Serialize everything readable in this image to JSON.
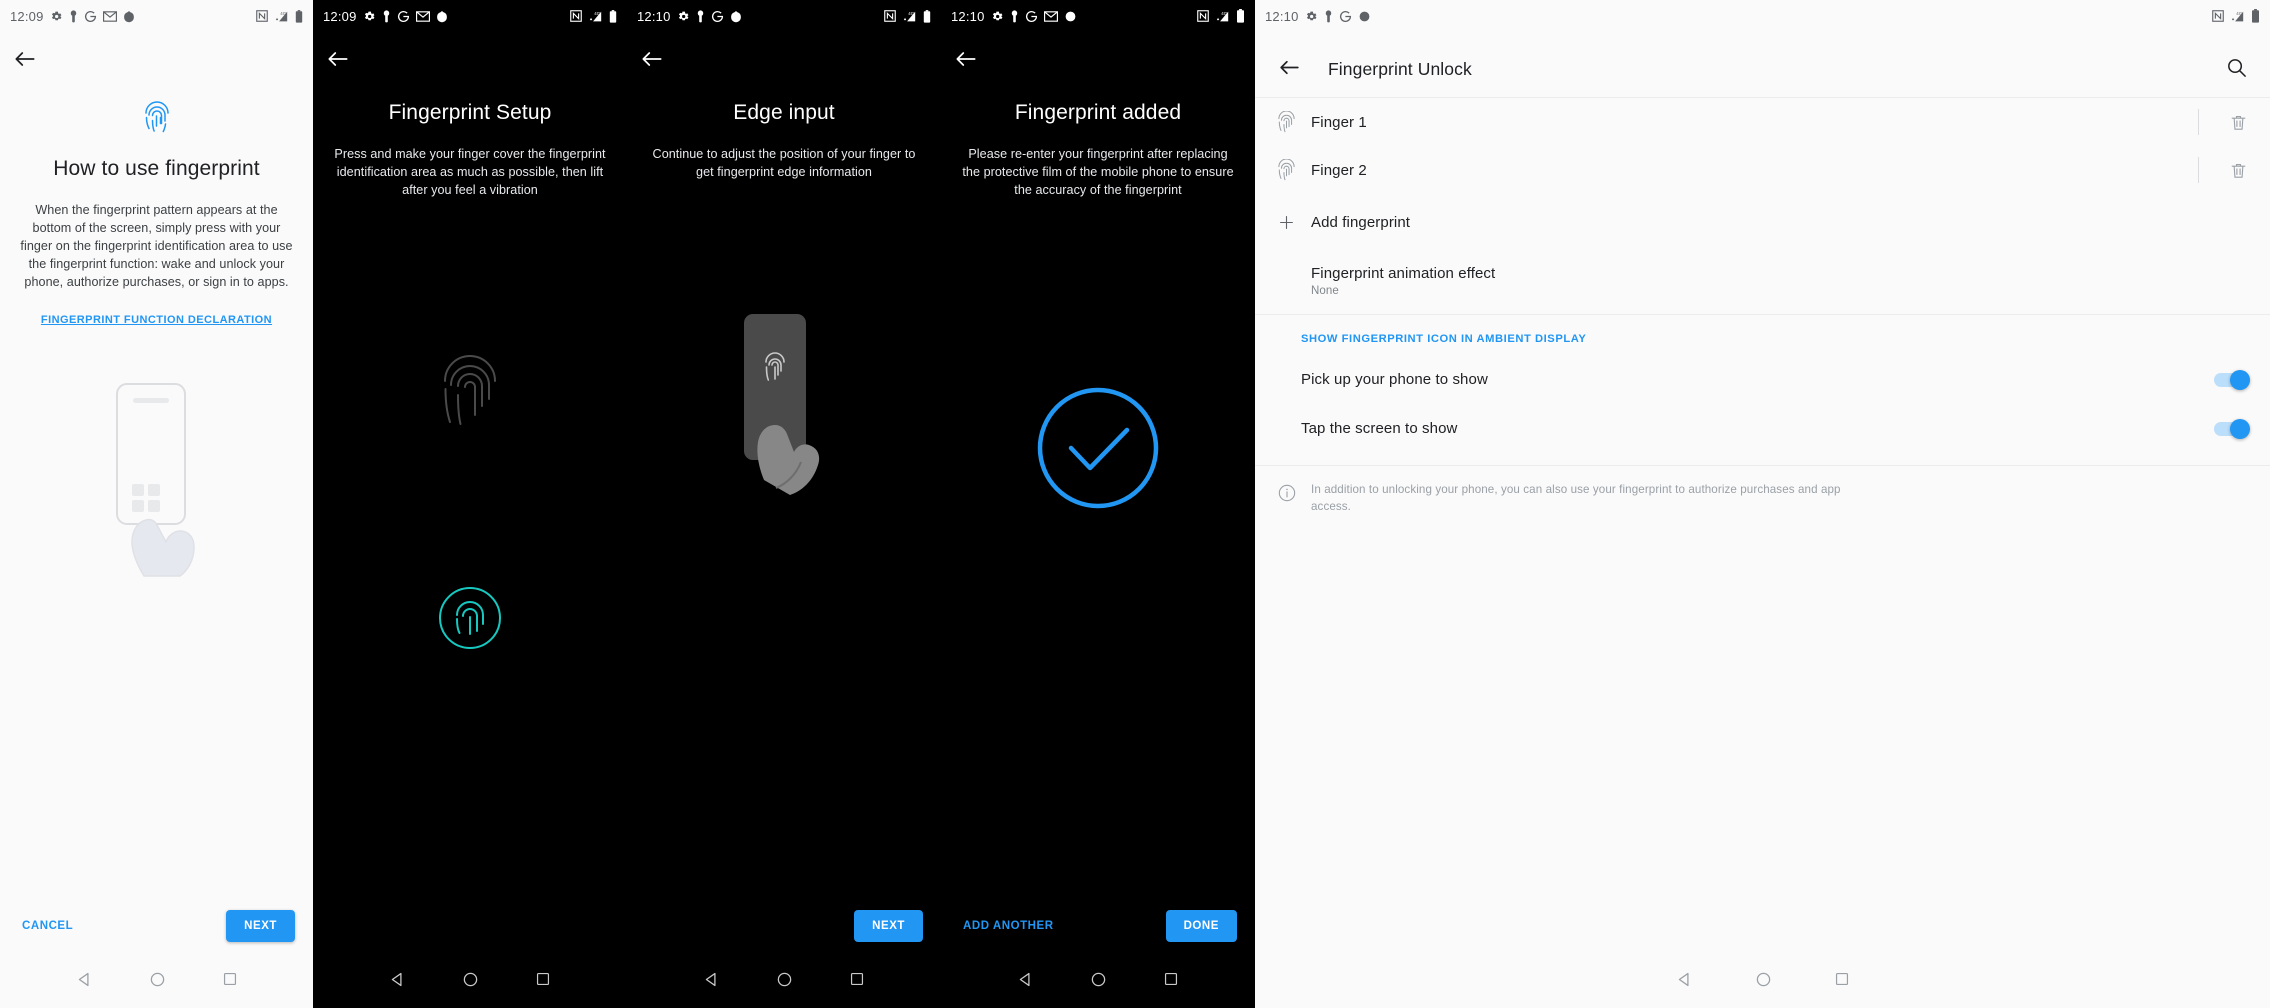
{
  "accent": "#2196f3",
  "panels": [
    {
      "id": "how-to-use-fingerprint",
      "theme": "light",
      "status": {
        "clock": "12:09",
        "left_icons": [
          "gear-icon",
          "vpn-key-icon",
          "google-icon",
          "gmail-icon",
          "app-dot-icon"
        ],
        "right_icons": [
          "nfc-icon",
          "signal-4g-icon",
          "battery-icon"
        ]
      },
      "title": "How to use fingerprint",
      "desc": "When the fingerprint pattern appears at the bottom of the screen, simply press with your finger on the fingerprint identification area to use the fingerprint function: wake and unlock your phone, authorize purchases, or sign in to apps.",
      "link": "FINGERPRINT FUNCTION DECLARATION",
      "left_button": "CANCEL",
      "right_button": "NEXT"
    },
    {
      "id": "fingerprint-setup",
      "theme": "dark",
      "status": {
        "clock": "12:09",
        "left_icons": [
          "gear-icon",
          "vpn-key-icon",
          "google-icon",
          "gmail-icon",
          "app-dot-icon"
        ],
        "right_icons": [
          "nfc-icon",
          "signal-4g-icon",
          "battery-icon"
        ]
      },
      "title": "Fingerprint Setup",
      "desc": "Press and make your finger cover the fingerprint identification area as much as possible, then lift after you feel a vibration"
    },
    {
      "id": "edge-input",
      "theme": "dark",
      "status": {
        "clock": "12:10",
        "left_icons": [
          "gear-icon",
          "vpn-key-icon",
          "google-icon",
          "app-dot-icon"
        ],
        "right_icons": [
          "nfc-icon",
          "signal-4g-icon",
          "battery-icon"
        ]
      },
      "title": "Edge input",
      "desc": "Continue to adjust the position of your finger to get fingerprint edge information",
      "right_button": "NEXT"
    },
    {
      "id": "fingerprint-added",
      "theme": "dark",
      "status": {
        "clock": "12:10",
        "left_icons": [
          "gear-icon",
          "vpn-key-icon",
          "google-icon",
          "gmail-icon",
          "app-dot-icon"
        ],
        "right_icons": [
          "nfc-icon",
          "signal-4g-icon",
          "battery-icon"
        ]
      },
      "title": "Fingerprint added",
      "desc": "Please re-enter your fingerprint after replacing the protective film of the mobile phone to ensure the accuracy of the fingerprint",
      "left_button": "ADD ANOTHER",
      "right_button": "DONE"
    }
  ],
  "settings": {
    "status": {
      "clock": "12:10",
      "left_icons": [
        "gear-icon",
        "vpn-key-icon",
        "google-icon",
        "app-dot-icon"
      ],
      "right_icons": [
        "nfc-icon",
        "signal-4g-icon",
        "battery-icon"
      ]
    },
    "appbar_title": "Fingerprint Unlock",
    "search_icon": "search-icon",
    "fingers": [
      {
        "label": "Finger 1"
      },
      {
        "label": "Finger 2"
      }
    ],
    "add_fingerprint": "Add fingerprint",
    "animation_effect": {
      "label": "Fingerprint animation effect",
      "value": "None"
    },
    "section_header": "SHOW FINGERPRINT ICON IN AMBIENT DISPLAY",
    "toggles": [
      {
        "label": "Pick up your phone to show",
        "on": true
      },
      {
        "label": "Tap the screen to show",
        "on": true
      }
    ],
    "footnote": "In addition to unlocking your phone, you can also use your fingerprint to authorize purchases and app access."
  },
  "navbar": {
    "back": "nav-back-icon",
    "home": "nav-home-icon",
    "recents": "nav-recents-icon"
  }
}
